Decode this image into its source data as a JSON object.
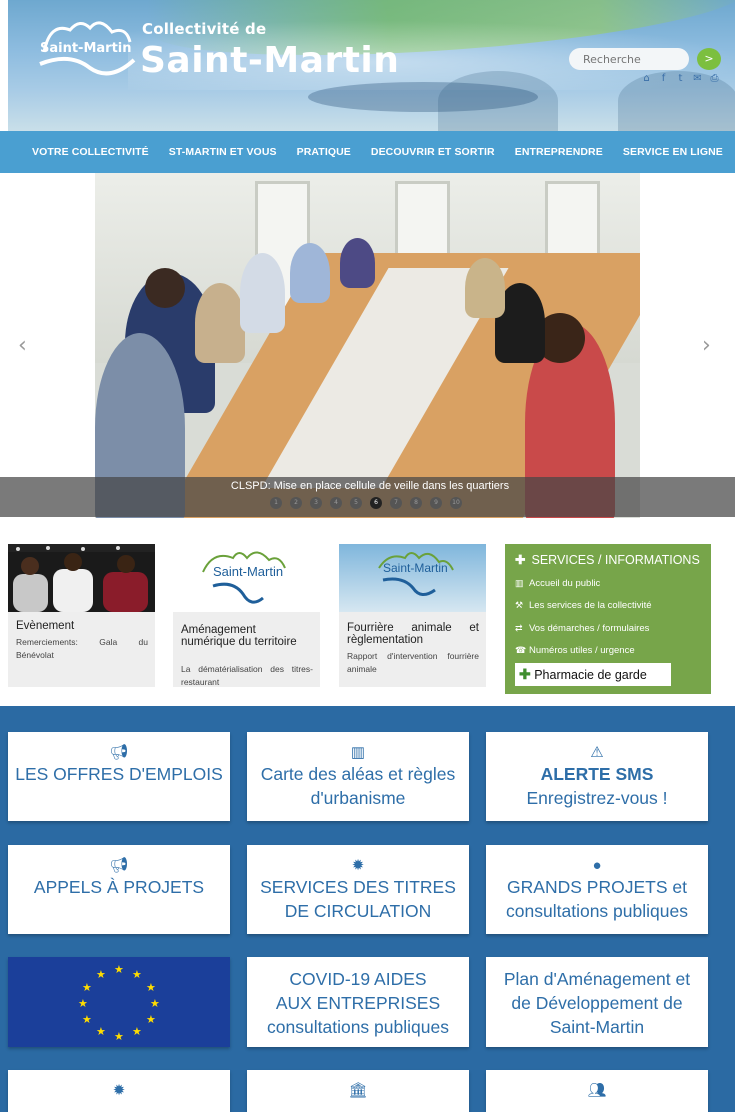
{
  "header": {
    "logo_text": "Saint-Martin",
    "title_small": "Collectivité de",
    "title_big": "Saint-Martin",
    "search_placeholder": "Recherche",
    "search_button": ">",
    "social_icons": [
      "home-icon",
      "facebook-icon",
      "twitter-icon",
      "mail-icon",
      "print-icon"
    ]
  },
  "nav": {
    "items": [
      "VOTRE COLLECTIVITÉ",
      "ST-MARTIN ET VOUS",
      "PRATIQUE",
      "DECOUVRIR ET SORTIR",
      "ENTREPRENDRE",
      "SERVICE EN LIGNE"
    ]
  },
  "carousel": {
    "caption": "CLSPD: Mise en place cellule de veille dans les quartiers",
    "dots": [
      "1",
      "2",
      "3",
      "4",
      "5",
      "6",
      "7",
      "8",
      "9",
      "10"
    ],
    "active_index": 6,
    "prev": "‹",
    "next": "›"
  },
  "news": [
    {
      "title": "Evènement",
      "desc": "Remerciements: Gala du Bénévolat"
    },
    {
      "title": "Aménagement numérique du territoire",
      "desc": "La dématérialisation des titres-restaurant",
      "logo_text": "Saint-Martin"
    },
    {
      "title": "Fourrière animale et règlementation",
      "desc": "Rapport d'intervention fourrière animale",
      "logo_text": "Saint-Martin"
    }
  ],
  "services": {
    "heading": "SERVICES / INFORMATIONS",
    "items": [
      {
        "icon": "map-icon",
        "label": "Accueil du public"
      },
      {
        "icon": "wrench-icon",
        "label": "Les services de la collectivité"
      },
      {
        "icon": "exchange-icon",
        "label": "Vos démarches / formulaires"
      },
      {
        "icon": "phone-icon",
        "label": "Numéros utiles / urgence"
      }
    ],
    "pharmacy": "Pharmacie de garde"
  },
  "cards": {
    "emplois": {
      "line1": "LES OFFRES D'EMPLOIS"
    },
    "aleas": {
      "line1": "Carte des aléas et règles",
      "line2": "d'urbanisme"
    },
    "alerte": {
      "line1": "ALERTE SMS",
      "line2": "Enregistrez-vous !"
    },
    "appels": {
      "line1": "APPELS À PROJETS"
    },
    "titres": {
      "line1": "SERVICES DES TITRES",
      "line2": "DE CIRCULATION"
    },
    "grands": {
      "line1": "GRANDS PROJETS et",
      "line2": "consultations publiques"
    },
    "covid": {
      "line1": "COVID-19 AIDES",
      "line2": "AUX ENTREPRISES",
      "line3": "consultations publiques"
    },
    "plan": {
      "line1": "Plan d'Aménagement et",
      "line2": "de Développement de",
      "line3": "Saint-Martin"
    }
  },
  "colors": {
    "nav_blue": "#4a9fd1",
    "section_blue": "#2b6aa3",
    "services_green": "#77a54a",
    "card_text": "#2e6ea8"
  }
}
